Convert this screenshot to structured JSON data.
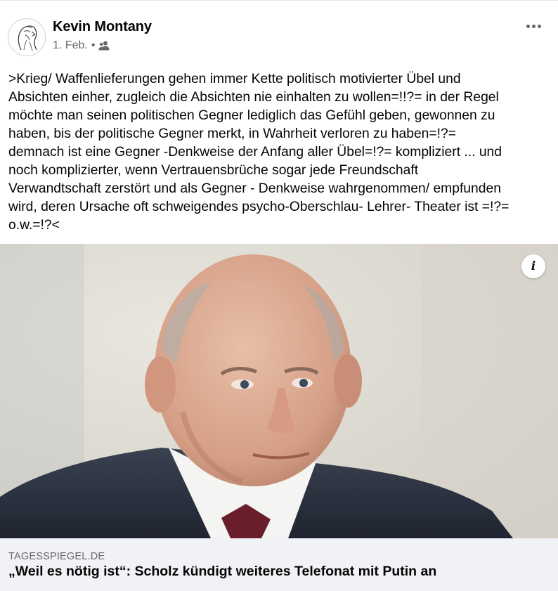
{
  "post": {
    "author": "Kevin Montany",
    "date": "1. Feb.",
    "separator": "•",
    "audience_icon": "friends-icon",
    "more_icon": "more-options-icon",
    "text": ">Krieg/ Waffenlieferungen gehen immer Kette politisch motivierter Übel und\nAbsichten einher, zugleich die Absichten nie einhalten zu wollen=!!?= in der Regel\nmöchte man seinen politischen Gegner lediglich das Gefühl geben, gewonnen zu\nhaben, bis der politische Gegner merkt, in Wahrheit verloren zu haben=!?=\ndemnach ist eine Gegner -Denkweise der Anfang aller Übel=!?= kompliziert ... und\nnoch komplizierter, wenn Vertrauensbrüche sogar jede Freundschaft\nVerwandtschaft zerstört und als Gegner - Denkweise wahrgenommen/ empfunden\nwird, deren Ursache oft schweigendes psycho-Oberschlau- Lehrer- Theater ist =!?=\no.w.=!?<"
  },
  "link": {
    "info_label": "i",
    "domain": "TAGESSPIEGEL.DE",
    "headline": "„Weil es nötig ist“: Scholz kündigt weiteres Telefonat mit Putin an"
  },
  "colors": {
    "text": "#050505",
    "secondary": "#65676b",
    "link_bg": "#f0f2f5"
  }
}
